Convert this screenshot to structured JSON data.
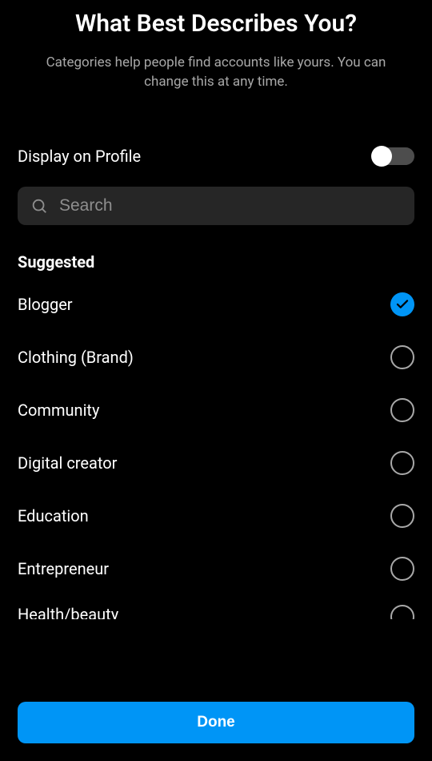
{
  "header": {
    "title": "What Best Describes You?",
    "subtitle": "Categories help people find accounts like yours. You can change this at any time."
  },
  "display_on_profile": {
    "label": "Display on Profile",
    "enabled": false
  },
  "search": {
    "placeholder": "Search",
    "value": ""
  },
  "section_heading": "Suggested",
  "categories": [
    {
      "label": "Blogger",
      "selected": true
    },
    {
      "label": "Clothing (Brand)",
      "selected": false
    },
    {
      "label": "Community",
      "selected": false
    },
    {
      "label": "Digital creator",
      "selected": false
    },
    {
      "label": "Education",
      "selected": false
    },
    {
      "label": "Entrepreneur",
      "selected": false
    },
    {
      "label": "Health/beauty",
      "selected": false
    }
  ],
  "footer": {
    "done_label": "Done"
  },
  "colors": {
    "accent": "#0095f6",
    "background": "#000000"
  }
}
